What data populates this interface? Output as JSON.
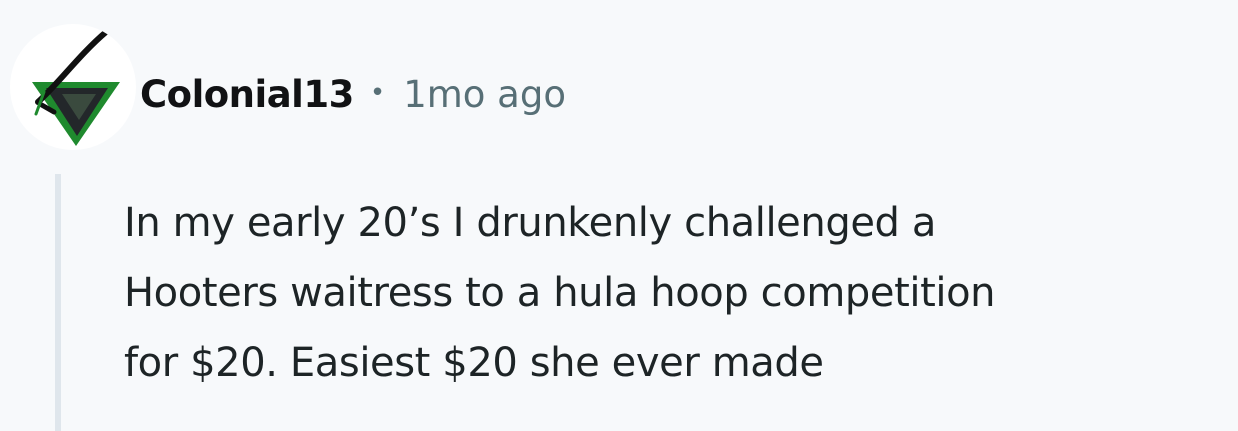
{
  "comment": {
    "author": "Colonial13",
    "separator": "•",
    "timestamp": "1mo ago",
    "body_lines": [
      "In my early 20’s I drunkenly challenged a",
      "Hooters waitress to a hula hoop competition",
      "for $20. Easiest $20 she ever made"
    ],
    "avatar_icon": "green-triangle-blade-icon",
    "colors": {
      "background": "#f7f9fb",
      "author": "#111214",
      "meta": "#576f76",
      "body": "#1d2426",
      "thread_line": "#dfe6ec",
      "avatar_green": "#1f8a2e"
    }
  }
}
